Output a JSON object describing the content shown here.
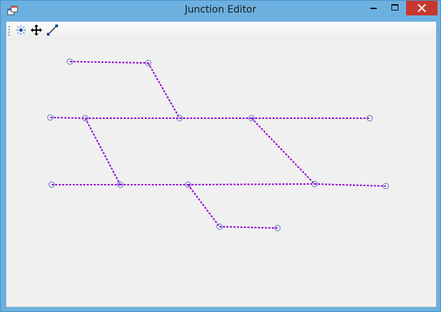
{
  "window": {
    "title": "Junction Editor"
  },
  "toolbar": {
    "tools": [
      {
        "icon": "add-node-icon",
        "active": false
      },
      {
        "icon": "move-icon",
        "active": true
      },
      {
        "icon": "connect-line-icon",
        "active": false
      }
    ]
  },
  "colors": {
    "line": "#9400d3",
    "node": "#5a78c8",
    "canvas": "#f0f0f0",
    "titlebar": "#6cb0e0",
    "close": "#c7372f"
  }
}
